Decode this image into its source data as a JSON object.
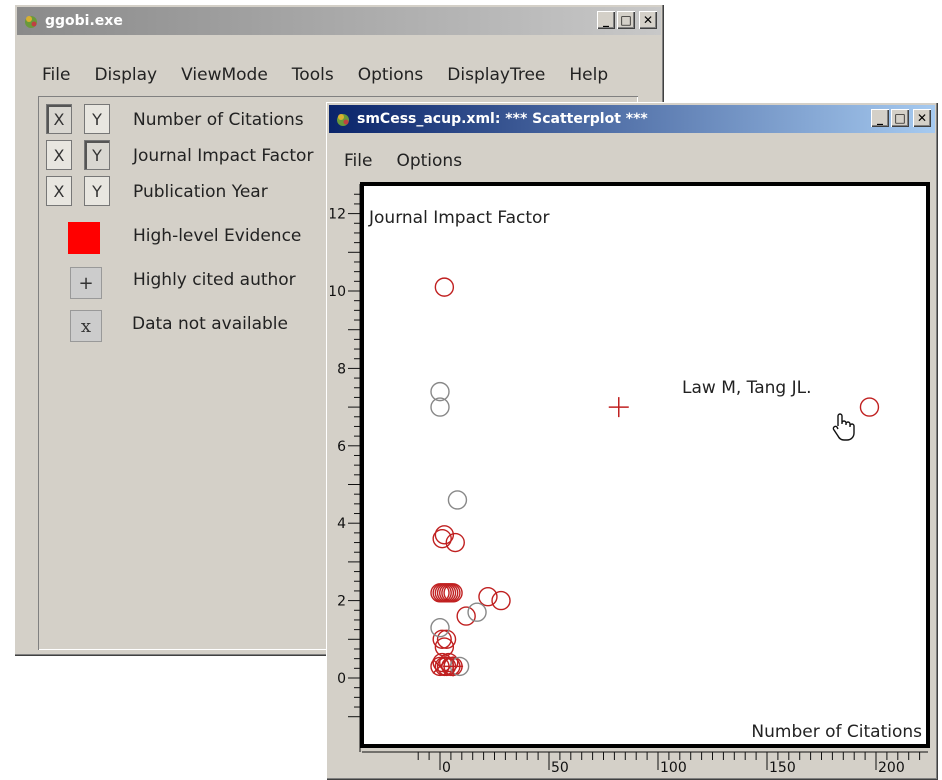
{
  "main_window": {
    "title": "ggobi.exe",
    "menu": [
      "File",
      "Display",
      "ViewMode",
      "Tools",
      "Options",
      "DisplayTree",
      "Help"
    ],
    "variables": [
      {
        "x": "X",
        "y": "Y",
        "name": "Number of Citations",
        "x_pressed": true,
        "y_pressed": false
      },
      {
        "x": "X",
        "y": "Y",
        "name": "Journal Impact Factor",
        "x_pressed": false,
        "y_pressed": true
      },
      {
        "x": "X",
        "y": "Y",
        "name": "Publication Year",
        "x_pressed": false,
        "y_pressed": false
      }
    ],
    "legend": [
      {
        "symbol": "",
        "label": "High-level Evidence",
        "color": "#ff0000"
      },
      {
        "symbol": "+",
        "label": "Highly cited author",
        "color": "#cccccc"
      },
      {
        "symbol": "x",
        "label": "Data not available",
        "color": "#cccccc"
      }
    ]
  },
  "scatter_window": {
    "title": "smCess_acup.xml: *** Scatterplot ***",
    "menu": [
      "File",
      "Options"
    ],
    "y_axis_label": "Journal Impact Factor",
    "x_axis_label": "Number of Citations",
    "annotation": "Law M, Tang JL.",
    "y_ruler_labels": [
      "12",
      "10",
      "8",
      "6",
      "4",
      "2",
      "0"
    ],
    "x_ruler_labels": [
      "0",
      "50",
      "100",
      "150",
      "200"
    ]
  },
  "colors": {
    "red_point": "#c02020",
    "grey_point": "#888888",
    "active_title": "#0a246a"
  },
  "chart_data": {
    "type": "scatter",
    "xlabel": "Number of Citations",
    "ylabel": "Journal Impact Factor",
    "xlim": [
      -10,
      220
    ],
    "ylim": [
      -1,
      12.5
    ],
    "annotation": {
      "text": "Law M, Tang JL.",
      "x": 196,
      "y": 7.0
    },
    "series": [
      {
        "color": "#c02020",
        "marker": "circle",
        "points": [
          [
            2,
            10.1
          ],
          [
            197,
            7.0
          ],
          [
            1,
            3.6
          ],
          [
            2,
            3.7
          ],
          [
            7,
            3.5
          ],
          [
            0,
            2.2
          ],
          [
            1,
            2.2
          ],
          [
            2,
            2.2
          ],
          [
            3,
            2.2
          ],
          [
            4,
            2.2
          ],
          [
            5,
            2.2
          ],
          [
            6,
            2.2
          ],
          [
            12,
            1.6
          ],
          [
            22,
            2.1
          ],
          [
            28,
            2.0
          ],
          [
            1,
            1.0
          ],
          [
            2,
            0.8
          ],
          [
            3,
            1.0
          ],
          [
            0,
            0.3
          ],
          [
            1,
            0.4
          ],
          [
            2,
            0.3
          ],
          [
            3,
            0.3
          ],
          [
            4,
            0.4
          ],
          [
            5,
            0.3
          ],
          [
            6,
            0.3
          ]
        ]
      },
      {
        "color": "#888888",
        "marker": "circle",
        "points": [
          [
            0,
            7.4
          ],
          [
            0,
            7.0
          ],
          [
            8,
            4.6
          ],
          [
            17,
            1.7
          ],
          [
            0,
            1.3
          ],
          [
            9,
            0.3
          ]
        ]
      },
      {
        "color": "#c02020",
        "marker": "plus",
        "points": [
          [
            82,
            7.0
          ],
          [
            6,
            0.3
          ]
        ]
      },
      {
        "color": "#c02020",
        "marker": "x",
        "points": [
          [
            0,
            0.3
          ]
        ]
      }
    ]
  }
}
